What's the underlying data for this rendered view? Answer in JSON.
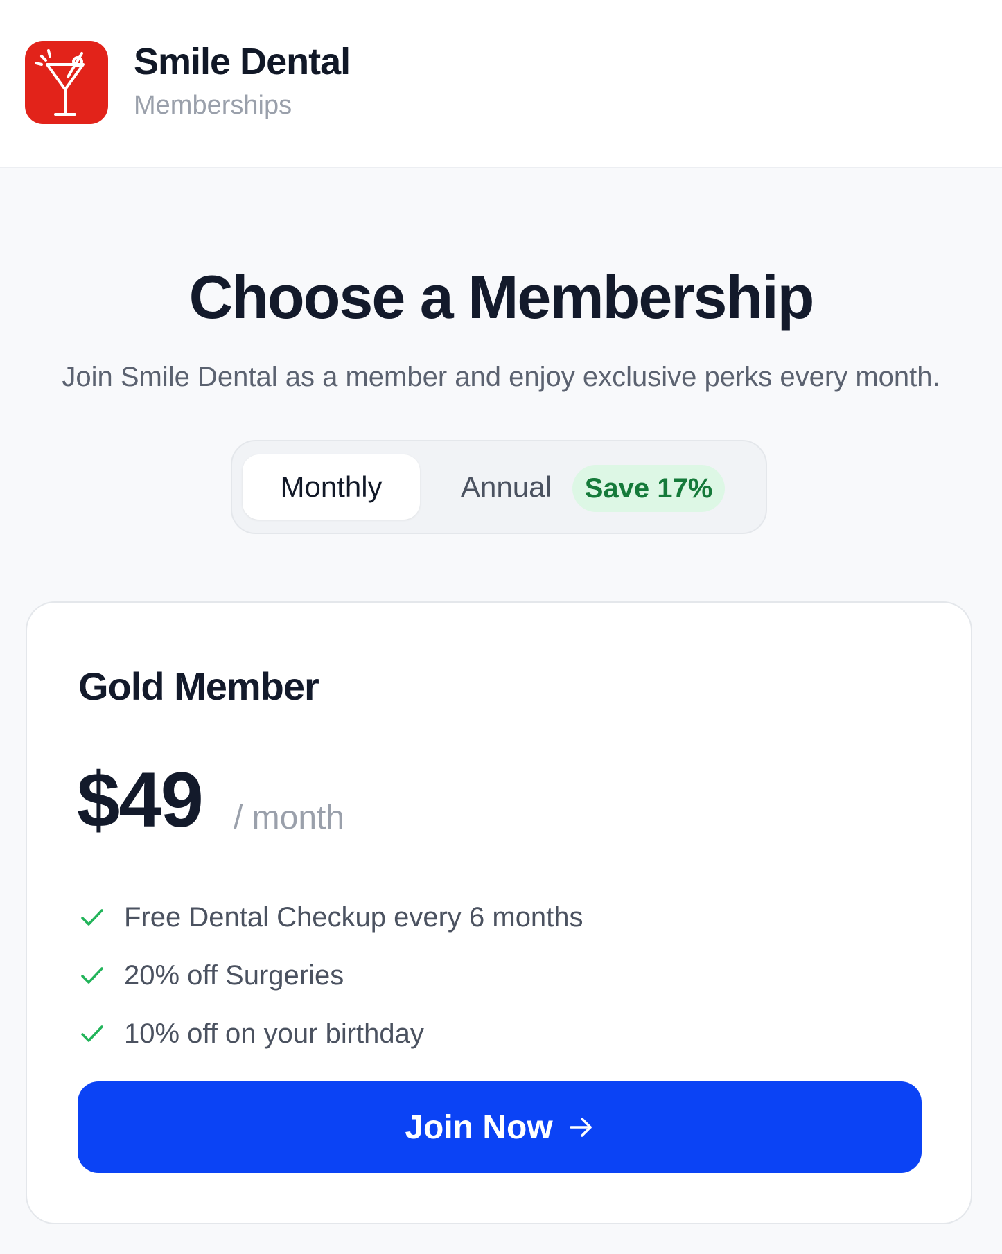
{
  "header": {
    "brand_name": "Smile Dental",
    "brand_subtitle": "Memberships",
    "logo_icon": "cocktail-glass-icon",
    "logo_color": "#e2231a"
  },
  "main": {
    "title": "Choose a Membership",
    "subtitle": "Join Smile Dental as a member and enjoy exclusive perks every month.",
    "billing_toggle": {
      "options": [
        {
          "label": "Monthly",
          "selected": true
        },
        {
          "label": "Annual",
          "selected": false
        }
      ],
      "badge": "Save 17%"
    },
    "plan": {
      "name": "Gold Member",
      "price": "$49",
      "period": "/ month",
      "features": [
        "Free Dental Checkup every 6 months",
        "20% off Surgeries",
        "10% off on your birthday"
      ],
      "cta_label": "Join Now",
      "cta_icon": "arrow-right-icon",
      "cta_color": "#0b43f5",
      "check_color": "#22b45a"
    }
  }
}
